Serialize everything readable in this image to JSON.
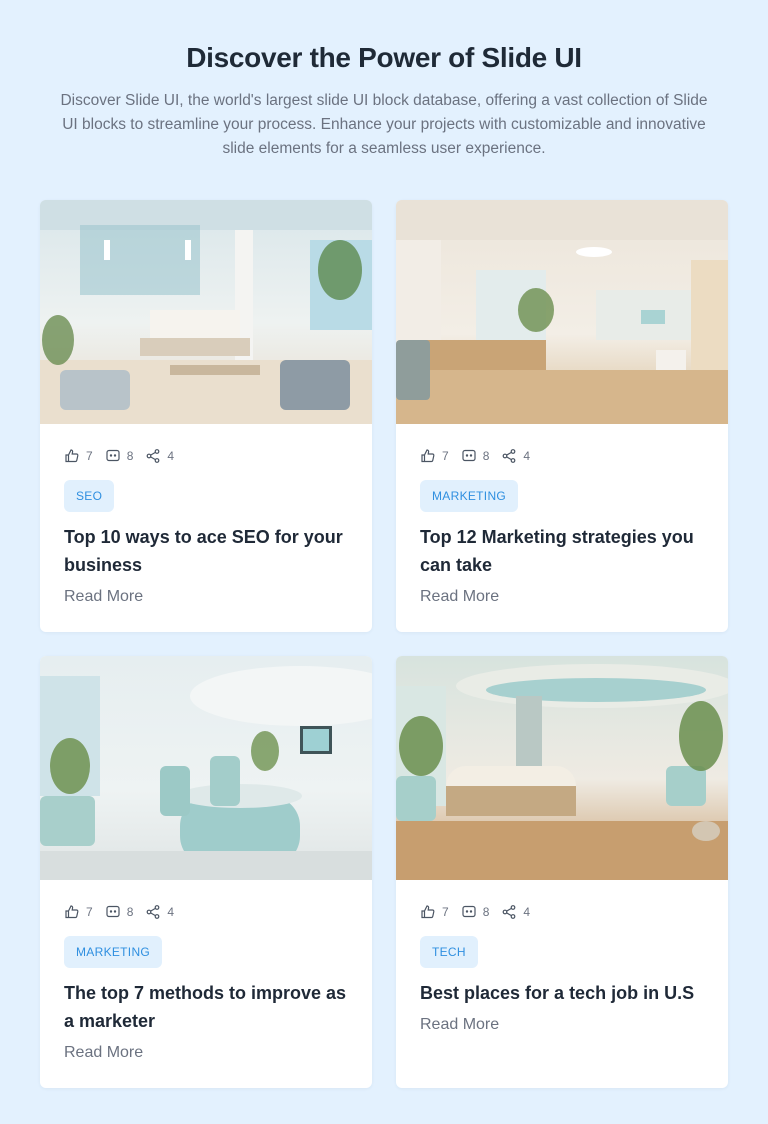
{
  "header": {
    "title": "Discover the Power of Slide UI",
    "subtitle": "Discover Slide UI, the world's largest slide UI block database, offering a vast collection of Slide UI blocks to streamline your process. Enhance your projects with customizable and innovative slide elements for a seamless user experience."
  },
  "cards": [
    {
      "likes": "7",
      "comments": "8",
      "shares": "4",
      "tag": "SEO",
      "title": "Top 10 ways to ace SEO for your business",
      "read_more": "Read More"
    },
    {
      "likes": "7",
      "comments": "8",
      "shares": "4",
      "tag": "MARKETING",
      "title": "Top 12 Marketing strategies you can take",
      "read_more": "Read More"
    },
    {
      "likes": "7",
      "comments": "8",
      "shares": "4",
      "tag": "MARKETING",
      "title": "The top 7 methods to improve as a marketer",
      "read_more": "Read More"
    },
    {
      "likes": "7",
      "comments": "8",
      "shares": "4",
      "tag": "TECH",
      "title": "Best places for a tech job in U.S",
      "read_more": "Read More"
    }
  ],
  "colors": {
    "background": "#e3f1fe",
    "tag_bg": "#e1f0fd",
    "tag_text": "#2f8fe0",
    "title": "#1f2937",
    "muted": "#6b7280"
  },
  "icons": {
    "likes": "thumbs-up-icon",
    "comments": "comment-icon",
    "shares": "share-icon"
  }
}
